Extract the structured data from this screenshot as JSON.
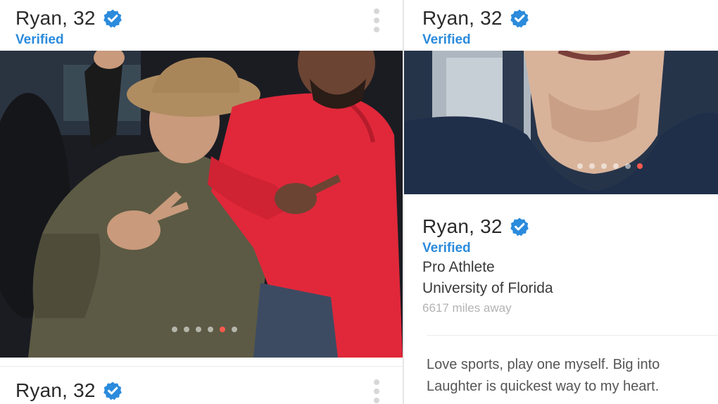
{
  "left_card": {
    "name": "Ryan, 32",
    "verified_label": "Verified",
    "photo_page": 5,
    "photo_count": 6
  },
  "left_card_next": {
    "name": "Ryan, 32"
  },
  "right_card": {
    "name": "Ryan, 32",
    "verified_label": "Verified",
    "photo_page": 6,
    "photo_count": 6,
    "info": {
      "name": "Ryan, 32",
      "verified_label": "Verified",
      "occupation": "Pro Athlete",
      "school": "University of Florida",
      "distance": "6617 miles away"
    },
    "bio_lines": [
      "Love sports, play one myself. Big into",
      "Laughter is quickest way to my heart."
    ]
  },
  "colors": {
    "verified_blue": "#2b8bdc",
    "active_dot": "#ff5a4e"
  },
  "icons": [
    "verified-check-icon",
    "more-options-icon"
  ]
}
